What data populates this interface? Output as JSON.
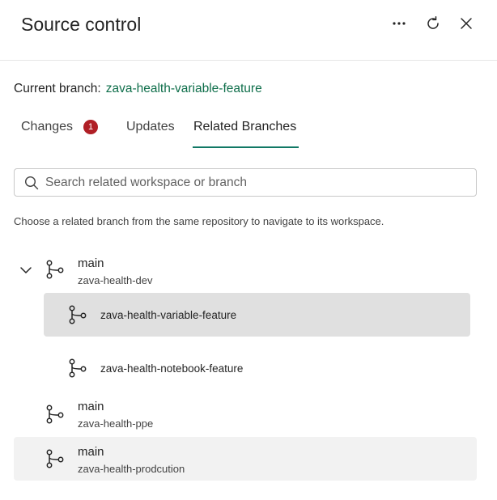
{
  "header": {
    "title": "Source control",
    "more_icon": "more-horizontal-icon",
    "refresh_icon": "refresh-icon",
    "close_icon": "close-icon"
  },
  "current_branch": {
    "label": "Current branch:",
    "value": "zava-health-variable-feature"
  },
  "tabs": [
    {
      "label": "Changes",
      "badge": "1"
    },
    {
      "label": "Updates"
    },
    {
      "label": "Related Branches",
      "active": true
    }
  ],
  "search": {
    "placeholder": "Search related workspace or branch",
    "value": ""
  },
  "description": "Choose a related branch from the same repository to navigate to its workspace.",
  "branches": [
    {
      "branch": "main",
      "workspace": "zava-health-dev",
      "expanded": true,
      "children": [
        {
          "workspace": "zava-health-variable-feature",
          "selected": true
        },
        {
          "workspace": "zava-health-notebook-feature"
        }
      ]
    },
    {
      "branch": "main",
      "workspace": "zava-health-ppe"
    },
    {
      "branch": "main",
      "workspace": "zava-health-prodcution",
      "hovered": true
    }
  ],
  "colors": {
    "accent": "#117865",
    "branch_link": "#0e6e4a",
    "badge": "#b01f26",
    "selected_row": "#e0e0e0",
    "hover_row": "#f2f2f2"
  }
}
